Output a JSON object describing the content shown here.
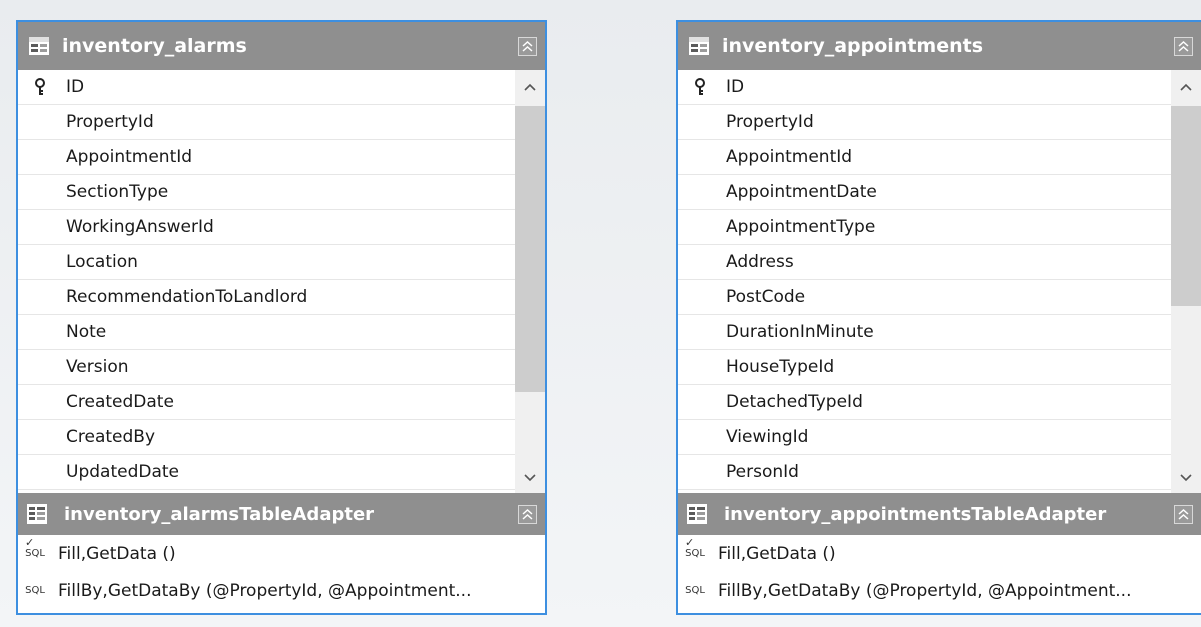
{
  "tables": [
    {
      "title": "inventory_alarms",
      "columns": [
        {
          "name": "ID",
          "key": true
        },
        {
          "name": "PropertyId",
          "key": false
        },
        {
          "name": "AppointmentId",
          "key": false
        },
        {
          "name": "SectionType",
          "key": false
        },
        {
          "name": "WorkingAnswerId",
          "key": false
        },
        {
          "name": "Location",
          "key": false
        },
        {
          "name": "RecommendationToLandlord",
          "key": false
        },
        {
          "name": "Note",
          "key": false
        },
        {
          "name": "Version",
          "key": false
        },
        {
          "name": "CreatedDate",
          "key": false
        },
        {
          "name": "CreatedBy",
          "key": false
        },
        {
          "name": "UpdatedDate",
          "key": false
        }
      ],
      "adapter": {
        "title": "inventory_alarmsTableAdapter",
        "queries": [
          {
            "badge": "SQL",
            "default": true,
            "text": "Fill,GetData ()"
          },
          {
            "badge": "SQL",
            "default": false,
            "text": "FillBy,GetDataBy (@PropertyId, @Appointment..."
          }
        ]
      }
    },
    {
      "title": "inventory_appointments",
      "columns": [
        {
          "name": "ID",
          "key": true
        },
        {
          "name": "PropertyId",
          "key": false
        },
        {
          "name": "AppointmentId",
          "key": false
        },
        {
          "name": "AppointmentDate",
          "key": false
        },
        {
          "name": "AppointmentType",
          "key": false
        },
        {
          "name": "Address",
          "key": false
        },
        {
          "name": "PostCode",
          "key": false
        },
        {
          "name": "DurationInMinute",
          "key": false
        },
        {
          "name": "HouseTypeId",
          "key": false
        },
        {
          "name": "DetachedTypeId",
          "key": false
        },
        {
          "name": "ViewingId",
          "key": false
        },
        {
          "name": "PersonId",
          "key": false
        }
      ],
      "adapter": {
        "title": "inventory_appointmentsTableAdapter",
        "queries": [
          {
            "badge": "SQL",
            "default": true,
            "text": "Fill,GetData ()"
          },
          {
            "badge": "SQL",
            "default": false,
            "text": "FillBy,GetDataBy (@PropertyId, @Appointment..."
          }
        ]
      }
    }
  ],
  "icons": {
    "table": "table-icon",
    "adapter": "table-adapter-icon",
    "key": "primary-key-icon",
    "collapse": "collapse-chevron-icon",
    "scroll_up": "scroll-up-arrow-icon",
    "scroll_down": "scroll-down-arrow-icon"
  },
  "colors": {
    "header_bg": "#8f8f8f",
    "selection_border": "#3d8fe0",
    "canvas_bg": "#eef0f3"
  }
}
